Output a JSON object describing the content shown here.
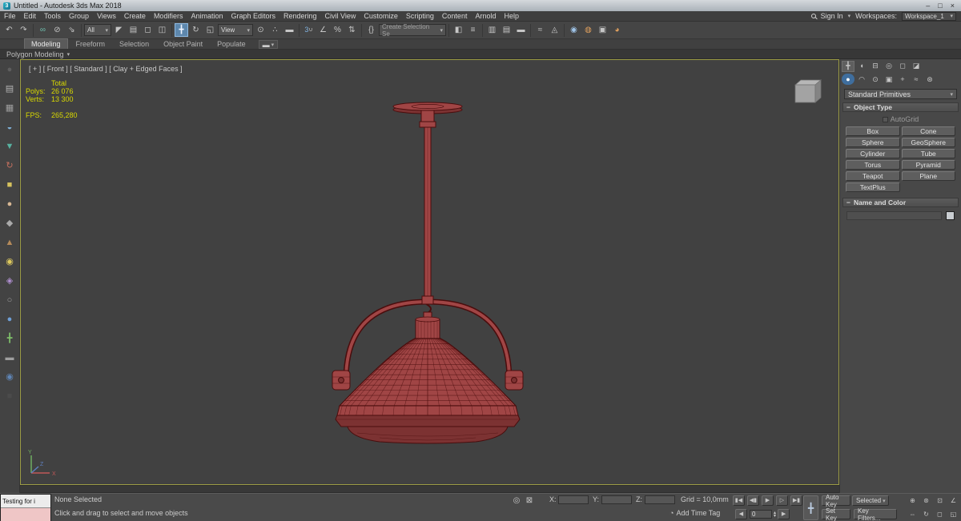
{
  "window": {
    "title": "Untitled - Autodesk 3ds Max 2018"
  },
  "menu_bar": {
    "items": [
      "File",
      "Edit",
      "Tools",
      "Group",
      "Views",
      "Create",
      "Modifiers",
      "Animation",
      "Graph Editors",
      "Rendering",
      "Civil View",
      "Customize",
      "Scripting",
      "Content",
      "Arnold",
      "Help"
    ],
    "sign_in_label": "Sign In",
    "workspaces_label": "Workspaces:",
    "workspace_value": "Workspace_1"
  },
  "toolbar": {
    "selection_filter_value": "All",
    "coordinate_system_value": "View",
    "named_selection_value": "Create Selection Se"
  },
  "ribbon": {
    "tabs": [
      "Modeling",
      "Freeform",
      "Selection",
      "Object Paint",
      "Populate"
    ],
    "panel_label": "Polygon Modeling"
  },
  "viewport": {
    "label": "[ + ] [ Front ] [ Standard ] [ Clay + Edged Faces ]",
    "axis": {
      "x": "X",
      "y": "Y",
      "z": "Z"
    },
    "stats": {
      "total_label": "Total",
      "polys_label": "Polys:",
      "polys_value": "26 076",
      "verts_label": "Verts:",
      "verts_value": "13 300",
      "fps_label": "FPS:",
      "fps_value": "265,280"
    }
  },
  "command_panel": {
    "category_value": "Standard Primitives",
    "object_type_label": "Object Type",
    "autogrid_label": "AutoGrid",
    "object_buttons": [
      "Box",
      "Cone",
      "Sphere",
      "GeoSphere",
      "Cylinder",
      "Tube",
      "Torus",
      "Pyramid",
      "Teapot",
      "Plane",
      "TextPlus"
    ],
    "name_color_label": "Name and Color"
  },
  "status_bar": {
    "selection_status": "None Selected",
    "prompt_line": "Click and drag to select and move objects",
    "mini_listener_text": "Testing for i",
    "x_label": "X:",
    "y_label": "Y:",
    "z_label": "Z:",
    "grid_label": "Grid = 10,0mm",
    "add_time_tag_label": "Add Time Tag",
    "auto_key_label": "Auto Key",
    "set_key_label": "Set Key",
    "key_mode_value": "Selected",
    "key_filters_label": "Key Filters...",
    "frame_value": "0"
  },
  "left_toolbar": {
    "icons": [
      "●",
      "▤",
      "▦",
      "◒",
      "▼",
      "↻",
      "■",
      "●",
      "◆",
      "▲",
      "◉",
      "◈",
      "○",
      "●",
      "╋",
      "▬",
      "◉",
      "■"
    ]
  },
  "icons": {
    "app_badge": "3",
    "minimize": "–",
    "maximize": "□",
    "close": "×",
    "caret": "▾",
    "rollout_minus": "−",
    "undo": "↶",
    "redo": "↷",
    "link": "∞",
    "unlink": "⊘",
    "bind_spacewarp": "⇘",
    "select_object": "◤",
    "select_by_name": "▤",
    "region_rect": "◻",
    "window_crossing": "◫",
    "move": "╋",
    "rotate": "↻",
    "scale": "◱",
    "pivot_center": "⊙",
    "manipulate": "∴",
    "keyboard_override": "▬",
    "snaps_3d": "3",
    "snap_magnet": "∪",
    "angle_snap": "∠",
    "percent_snap": "%",
    "spinner_snap": "⇅",
    "edit_sel_sets": "{}",
    "mirror": "◧",
    "align": "≡",
    "scene_explorer": "▥",
    "layer_manager": "▤",
    "toggle_ribbon": "▬",
    "curve_editor": "≈",
    "schematic_view": "◬",
    "material_editor": "◉",
    "render_setup": "◍",
    "rendered_frame": "▣",
    "render_production": "◕",
    "isolate": "◎",
    "lock_selection": "⊠",
    "go_start": "▮◀",
    "prev_key": "◀▮",
    "play": "▶",
    "next_frame": "▷",
    "go_end": "▶▮",
    "big_key": "╋",
    "frame_back": "◀",
    "frame_fwd": "▶",
    "spin_up": "▴",
    "spin_down": "▾",
    "time_tag": "◔",
    "zoom": "⊕",
    "zoom_all": "⊛",
    "zoom_extents": "⊡",
    "fov": "∠",
    "pan": "⇔",
    "orbit": "↻",
    "zoom_region": "◻",
    "maximize_viewport": "◱",
    "panel_create": "╋",
    "panel_modify": "◖",
    "panel_hierarchy": "⊟",
    "panel_motion": "◎",
    "panel_display": "◻",
    "panel_utilities": "◪",
    "cat_geometry": "●",
    "cat_shapes": "◠",
    "cat_lights": "⊙",
    "cat_cameras": "▣",
    "cat_helpers": "+",
    "cat_space_warps": "≈",
    "cat_systems": "⊛"
  },
  "colors": {
    "viewport_border": "#9c9c45",
    "stats_yellow": "#d9d900",
    "accent_blue": "#5d87ad",
    "model_stroke": "#4a0d0d",
    "model_fill": "#a04545",
    "model_dark": "#7c3232",
    "model_light": "#b25a5a"
  }
}
